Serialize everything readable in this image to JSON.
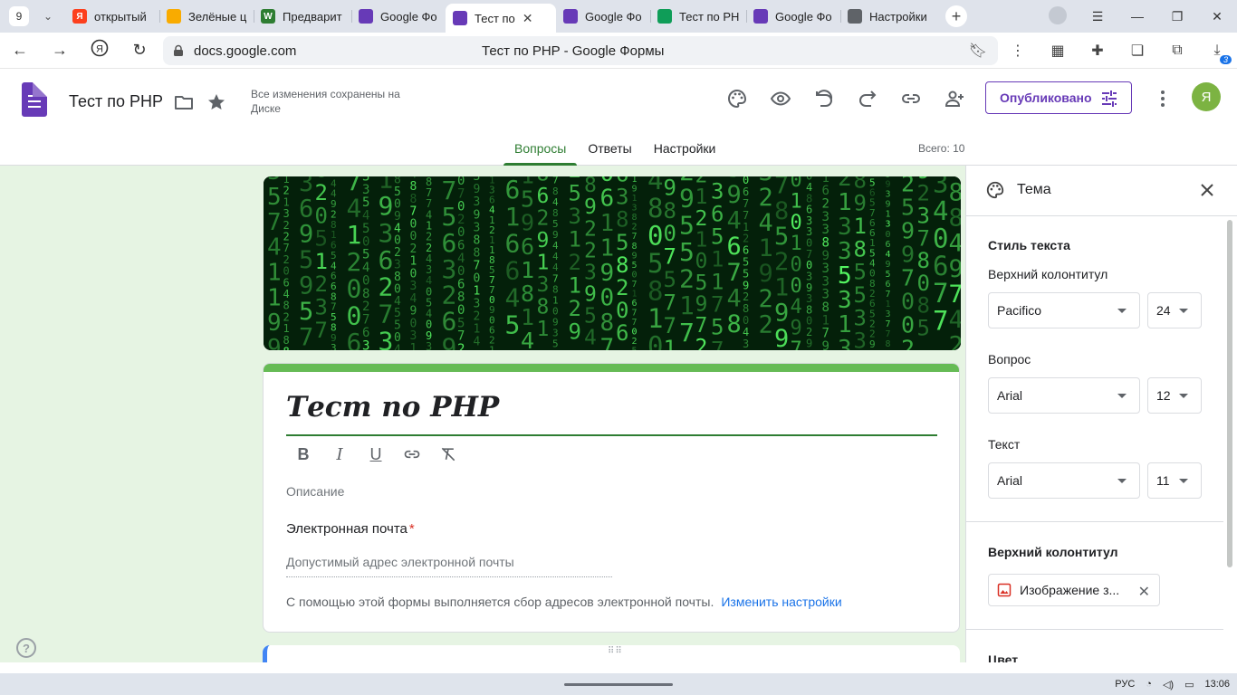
{
  "browser": {
    "tab_count": "9",
    "tabs": [
      {
        "label": "открытый",
        "color": "#fc3f1d",
        "icon": "Я"
      },
      {
        "label": "Зелёные ц",
        "color": "#f9ab00",
        "icon": ""
      },
      {
        "label": "Предварит",
        "color": "#2e7d32",
        "icon": "W"
      },
      {
        "label": "Google Фо",
        "color": "#673ab7",
        "icon": ""
      },
      {
        "label": "Тест по",
        "color": "#673ab7",
        "icon": "",
        "active": true
      },
      {
        "label": "Google Фо",
        "color": "#673ab7",
        "icon": ""
      },
      {
        "label": "Тест по PH",
        "color": "#0f9d58",
        "icon": ""
      },
      {
        "label": "Google Фо",
        "color": "#673ab7",
        "icon": ""
      },
      {
        "label": "Настройки",
        "color": "#5f6368",
        "icon": ""
      }
    ],
    "url": "docs.google.com",
    "page_title": "Тест по PHP - Google Формы",
    "downloads_badge": "3"
  },
  "header": {
    "doc_title": "Тест по PHP",
    "save_status": "Все изменения сохранены на Диске",
    "publish_label": "Опубликовано",
    "avatar_letter": "Я",
    "tabs": [
      "Вопросы",
      "Ответы",
      "Настройки"
    ],
    "total": "Всего: 10"
  },
  "form": {
    "title": "Тест по PHP",
    "description_placeholder": "Описание",
    "email_label": "Электронная почта",
    "required_mark": "*",
    "email_placeholder": "Допустимый адрес электронной почты",
    "collect_note": "С помощью этой формы выполняется сбор адресов электронной почты.",
    "collect_link": "Изменить настройки"
  },
  "theme": {
    "title": "Тема",
    "text_style_title": "Стиль текста",
    "header_label": "Верхний колонтитул",
    "header_font": "Pacifico",
    "header_size": "24",
    "question_label": "Вопрос",
    "question_font": "Arial",
    "question_size": "12",
    "text_label": "Текст",
    "text_font": "Arial",
    "text_size": "11",
    "header_image_title": "Верхний колонтитул",
    "header_image_name": "Изображение з...",
    "color_title": "Цвет"
  },
  "taskbar": {
    "lang": "РУС",
    "time": "13:06"
  },
  "colors": {
    "accent": "#673ab7",
    "theme_green": "#2e7d32",
    "page_bg": "#e6f4e3"
  }
}
